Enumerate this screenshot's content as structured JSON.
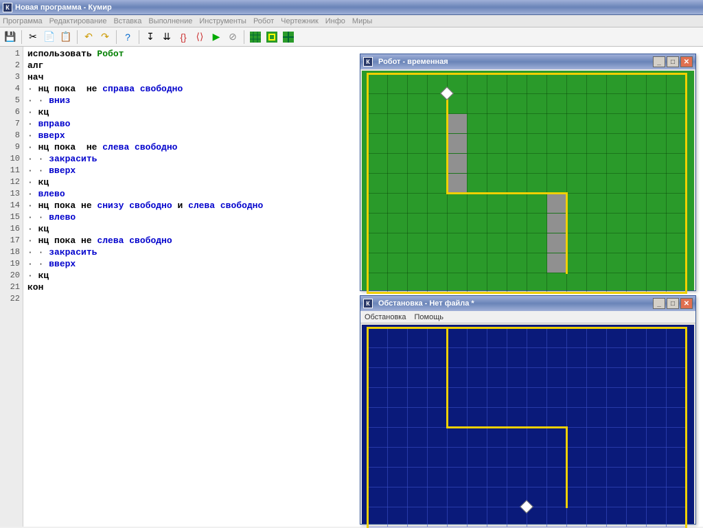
{
  "app": {
    "title": "Новая программа - Кумир",
    "iconLetter": "К"
  },
  "menubar": [
    "Программа",
    "Редактирование",
    "Вставка",
    "Выполнение",
    "Инструменты",
    "Робот",
    "Чертежник",
    "Инфо",
    "Миры"
  ],
  "code": {
    "lines": [
      [
        {
          "t": "использовать ",
          "c": "kw-black"
        },
        {
          "t": "Робот",
          "c": "kw-green"
        }
      ],
      [
        {
          "t": "алг",
          "c": "kw-black"
        }
      ],
      [
        {
          "t": "нач",
          "c": "kw-black"
        }
      ],
      [
        {
          "t": "· ",
          "c": "dot"
        },
        {
          "t": "нц пока",
          "c": "kw-black"
        },
        {
          "t": "  не ",
          "c": "kw-black"
        },
        {
          "t": "справа свободно",
          "c": "kw-blue"
        }
      ],
      [
        {
          "t": "· · ",
          "c": "dot"
        },
        {
          "t": "вниз",
          "c": "kw-blue"
        }
      ],
      [
        {
          "t": "· ",
          "c": "dot"
        },
        {
          "t": "кц",
          "c": "kw-black"
        }
      ],
      [
        {
          "t": "· ",
          "c": "dot"
        },
        {
          "t": "вправо",
          "c": "kw-blue"
        }
      ],
      [
        {
          "t": "· ",
          "c": "dot"
        },
        {
          "t": "вверх",
          "c": "kw-blue"
        }
      ],
      [
        {
          "t": "· ",
          "c": "dot"
        },
        {
          "t": "нц пока",
          "c": "kw-black"
        },
        {
          "t": "  не ",
          "c": "kw-black"
        },
        {
          "t": "слева свободно",
          "c": "kw-blue"
        }
      ],
      [
        {
          "t": "· · ",
          "c": "dot"
        },
        {
          "t": "закрасить",
          "c": "kw-blue"
        }
      ],
      [
        {
          "t": "· · ",
          "c": "dot"
        },
        {
          "t": "вверх",
          "c": "kw-blue"
        }
      ],
      [
        {
          "t": "· ",
          "c": "dot"
        },
        {
          "t": "кц",
          "c": "kw-black"
        }
      ],
      [
        {
          "t": "· ",
          "c": "dot"
        },
        {
          "t": "влево",
          "c": "kw-blue"
        }
      ],
      [
        {
          "t": "· ",
          "c": "dot"
        },
        {
          "t": "нц пока не ",
          "c": "kw-black"
        },
        {
          "t": "снизу свободно",
          "c": "kw-blue"
        },
        {
          "t": " и ",
          "c": "kw-black"
        },
        {
          "t": "слева свободно",
          "c": "kw-blue"
        }
      ],
      [
        {
          "t": "· · ",
          "c": "dot"
        },
        {
          "t": "влево",
          "c": "kw-blue"
        }
      ],
      [
        {
          "t": "· ",
          "c": "dot"
        },
        {
          "t": "кц",
          "c": "kw-black"
        }
      ],
      [
        {
          "t": "· ",
          "c": "dot"
        },
        {
          "t": "нц пока не ",
          "c": "kw-black"
        },
        {
          "t": "слева свободно",
          "c": "kw-blue"
        }
      ],
      [
        {
          "t": "· · ",
          "c": "dot"
        },
        {
          "t": "закрасить",
          "c": "kw-blue"
        }
      ],
      [
        {
          "t": "· · ",
          "c": "dot"
        },
        {
          "t": "вверх",
          "c": "kw-blue"
        }
      ],
      [
        {
          "t": "· ",
          "c": "dot"
        },
        {
          "t": "кц",
          "c": "kw-black"
        }
      ],
      [
        {
          "t": "кон",
          "c": "kw-black"
        }
      ],
      [
        {
          "t": "",
          "c": ""
        }
      ]
    ]
  },
  "robotWin": {
    "title": "Робот - временная",
    "grid": {
      "cols": 16,
      "rows": 11,
      "cell": 29
    },
    "painted": [
      [
        4,
        2
      ],
      [
        4,
        3
      ],
      [
        4,
        4
      ],
      [
        4,
        5
      ],
      [
        9,
        6
      ],
      [
        9,
        7
      ],
      [
        9,
        8
      ],
      [
        9,
        9
      ]
    ],
    "walls_h": [
      {
        "r": 0,
        "c0": 0,
        "c1": 16
      },
      {
        "r": 11,
        "c0": 0,
        "c1": 16
      },
      {
        "r": 6,
        "c0": 4,
        "c1": 10
      }
    ],
    "walls_v": [
      {
        "c": 0,
        "r0": 0,
        "r1": 11
      },
      {
        "c": 16,
        "r0": 0,
        "r1": 11
      },
      {
        "c": 4,
        "r0": 1,
        "r1": 6
      },
      {
        "c": 10,
        "r0": 6,
        "r1": 10
      }
    ],
    "robot": {
      "col": 4,
      "row": 1
    }
  },
  "envWin": {
    "title": "Обстановка - Нет файла *",
    "menu": [
      "Обстановка",
      "Помощь"
    ],
    "grid": {
      "cols": 16,
      "rows": 10,
      "cell": 29
    },
    "walls_h": [
      {
        "r": 0,
        "c0": 0,
        "c1": 16
      },
      {
        "r": 5,
        "c0": 4,
        "c1": 10
      }
    ],
    "walls_v": [
      {
        "c": 0,
        "r0": 0,
        "r1": 10
      },
      {
        "c": 16,
        "r0": 0,
        "r1": 10
      },
      {
        "c": 4,
        "r0": 0,
        "r1": 5
      },
      {
        "c": 10,
        "r0": 5,
        "r1": 9
      }
    ],
    "robot": {
      "col": 8,
      "row": 9
    }
  }
}
